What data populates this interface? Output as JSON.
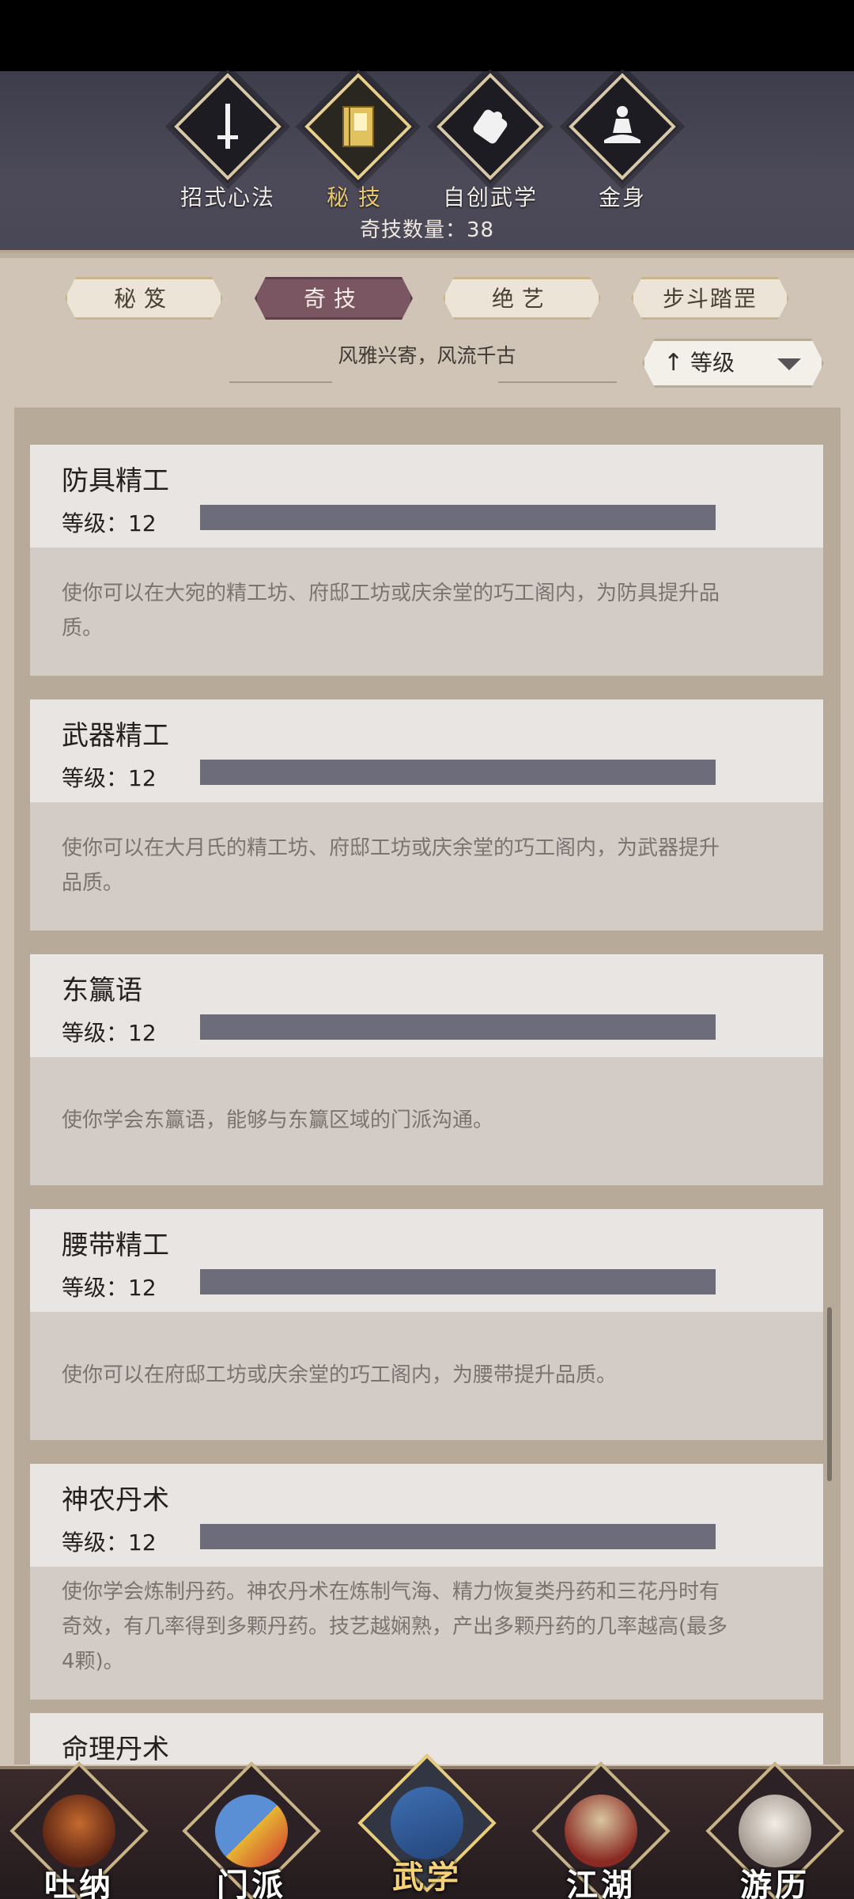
{
  "header": {
    "categories": [
      {
        "label": "招式心法",
        "icon": "sword-icon"
      },
      {
        "label": "秘技",
        "icon": "book-icon"
      },
      {
        "label": "自创武学",
        "icon": "scroll-icon"
      },
      {
        "label": "金身",
        "icon": "meditation-icon"
      }
    ],
    "count_text": "奇技数量：38"
  },
  "subtabs": [
    "秘笈",
    "奇技",
    "绝艺",
    "步斗踏罡"
  ],
  "motto": "风雅兴寄，风流千古",
  "sort": {
    "arrow": "↑",
    "label": "等级"
  },
  "skills": [
    {
      "name": "防具精工",
      "level": "等级：12",
      "desc": [
        "使你可以在大宛的精工坊、府邸工坊或庆余堂的巧工阁内，为防具提升品",
        "质。"
      ]
    },
    {
      "name": "武器精工",
      "level": "等级：12",
      "desc": [
        "使你可以在大月氏的精工坊、府邸工坊或庆余堂的巧工阁内，为武器提升",
        "品质。"
      ]
    },
    {
      "name": "东籯语",
      "level": "等级：12",
      "desc": [
        "使你学会东籯语，能够与东籯区域的门派沟通。"
      ]
    },
    {
      "name": "腰带精工",
      "level": "等级：12",
      "desc": [
        "使你可以在府邸工坊或庆余堂的巧工阁内，为腰带提升品质。"
      ]
    },
    {
      "name": "神农丹术",
      "level": "等级：12",
      "desc": [
        "使你学会炼制丹药。神农丹术在炼制气海、精力恢复类丹药和三花丹时有",
        "奇效，有几率得到多颗丹药。技艺越娴熟，产出多颗丹药的几率越高(最多",
        "4颗)。"
      ]
    },
    {
      "name": "命理丹术",
      "level": "",
      "desc": []
    }
  ],
  "bottom_nav": [
    "吐纳",
    "门派",
    "武学",
    "江湖",
    "游历"
  ]
}
